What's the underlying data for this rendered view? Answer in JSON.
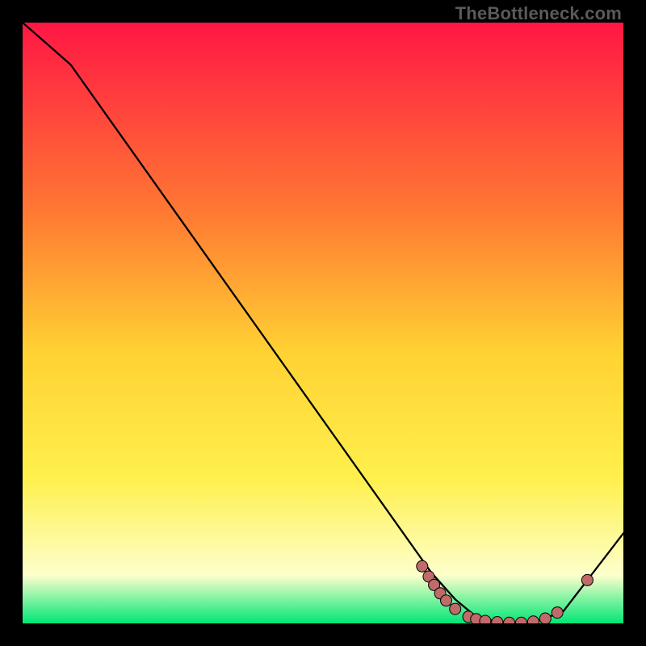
{
  "watermark": "TheBottleneck.com",
  "colors": {
    "gradient_top": "#ff1744",
    "gradient_mid_upper": "#ff7a33",
    "gradient_mid": "#ffd233",
    "gradient_mid_lower": "#fff04d",
    "gradient_pale": "#fdffcc",
    "gradient_green": "#00e676",
    "curve_stroke": "#000000",
    "marker_fill": "#c06a6a",
    "marker_stroke": "#000000",
    "frame_bg": "#000000"
  },
  "chart_data": {
    "type": "line",
    "title": "",
    "xlabel": "",
    "ylabel": "",
    "xlim": [
      0,
      1
    ],
    "ylim": [
      0,
      1
    ],
    "grid": false,
    "legend": false,
    "series": [
      {
        "name": "curve",
        "x": [
          0.0,
          0.04,
          0.08,
          0.68,
          0.72,
          0.75,
          0.78,
          0.82,
          0.86,
          0.9,
          1.0
        ],
        "y": [
          1.0,
          0.965,
          0.93,
          0.085,
          0.04,
          0.015,
          0.005,
          0.0,
          0.005,
          0.02,
          0.15
        ]
      }
    ],
    "markers": [
      {
        "x": 0.665,
        "y": 0.095
      },
      {
        "x": 0.676,
        "y": 0.078
      },
      {
        "x": 0.685,
        "y": 0.064
      },
      {
        "x": 0.695,
        "y": 0.05
      },
      {
        "x": 0.705,
        "y": 0.038
      },
      {
        "x": 0.72,
        "y": 0.024
      },
      {
        "x": 0.742,
        "y": 0.011
      },
      {
        "x": 0.755,
        "y": 0.007
      },
      {
        "x": 0.77,
        "y": 0.004
      },
      {
        "x": 0.79,
        "y": 0.002
      },
      {
        "x": 0.81,
        "y": 0.001
      },
      {
        "x": 0.83,
        "y": 0.001
      },
      {
        "x": 0.85,
        "y": 0.003
      },
      {
        "x": 0.87,
        "y": 0.008
      },
      {
        "x": 0.89,
        "y": 0.018
      },
      {
        "x": 0.94,
        "y": 0.072
      }
    ]
  }
}
